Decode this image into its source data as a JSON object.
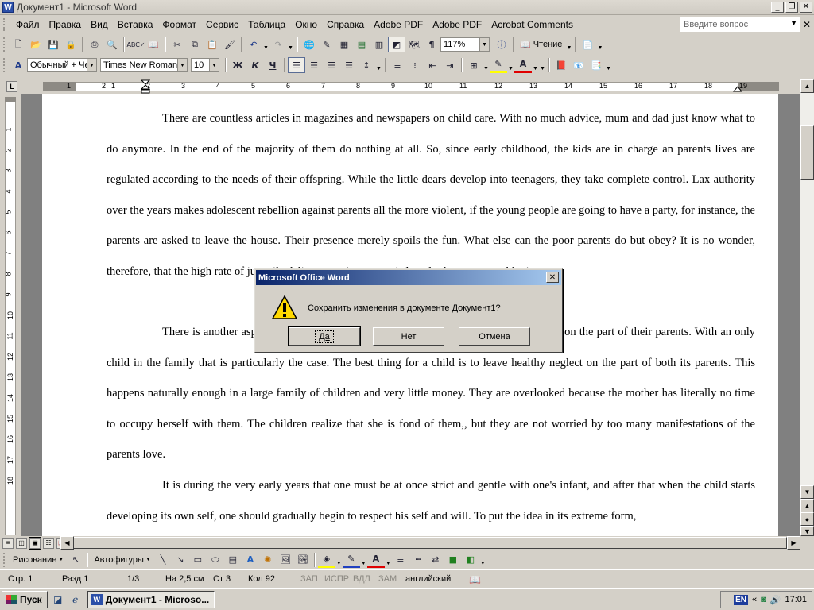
{
  "window": {
    "title": "Документ1 - Microsoft Word",
    "app_icon": "W"
  },
  "menu": {
    "items": [
      "Файл",
      "Правка",
      "Вид",
      "Вставка",
      "Формат",
      "Сервис",
      "Таблица",
      "Окно",
      "Справка",
      "Adobe PDF",
      "Adobe PDF",
      "Acrobat Comments"
    ],
    "ask_placeholder": "Введите вопрос"
  },
  "standard_toolbar": {
    "zoom": "117%",
    "read_label": "Чтение"
  },
  "format_toolbar": {
    "style": "Обычный + Че",
    "font": "Times New Roman",
    "size": "10",
    "bold_label": "Ж",
    "italic_label": "К",
    "underline_label": "Ч"
  },
  "ruler": {
    "numbers": [
      "1",
      "2",
      "1",
      "2",
      "3",
      "4",
      "5",
      "6",
      "7",
      "8",
      "9",
      "10",
      "11",
      "12",
      "13",
      "14",
      "15",
      "16",
      "17",
      "18",
      "19"
    ]
  },
  "vruler": {
    "numbers": [
      "1",
      "2",
      "3",
      "4",
      "5",
      "6",
      "7",
      "8",
      "9",
      "10",
      "11",
      "12",
      "13",
      "14",
      "15",
      "16",
      "17",
      "18"
    ]
  },
  "document": {
    "paragraphs": [
      "There are countless articles in magazines and newspapers on child care. With no much advice, mum and dad just know what to do anymore. In the end of the majority of them do nothing at all. So, since early childhood, the kids are in charge an parents lives are regulated according to the needs of their offspring. While the little dears develop into teenagers, they take complete control. Lax authority over the years makes adolescent rebellion against parents all the more violent, if the young people are going to have a party, for instance, the parents are asked to leave the house. Their presence merely spoils the fun. What else can the poor parents do but obey? It is no wonder, therefore, that the high rate of juvenile delinquency in our age is largely due to parental laxity.",
      "There is another aspect of the problem as children suffer as much from over attention on the part of their parents. With an only child in the family that is particularly the case. The best thing for a child is to leave healthy neglect on the part of both its parents. This happens naturally enough in a large family of children and very little money. They are overlooked because the mother has literally no time to occupy herself with them. The children realize that she is fond of them,, but they are not worried by too many manifestations of the parents love.",
      "It is during the very early years that one must be at once strict and gentle with one's infant, and after that when the child starts developing its own self, one should gradually begin to respect his self and will. To put the idea in its extreme form,"
    ]
  },
  "drawing_toolbar": {
    "draw_label": "Рисование",
    "autoshapes_label": "Автофигуры"
  },
  "status": {
    "page": "Стр. 1",
    "section": "Разд 1",
    "pages": "1/3",
    "at": "На 2,5 см",
    "line": "Ст 3",
    "col": "Кол 92",
    "rec": "ЗАП",
    "trk": "ИСПР",
    "ext": "ВДЛ",
    "ovr": "ЗАМ",
    "lang": "английский"
  },
  "taskbar": {
    "start": "Пуск",
    "task": "Документ1 - Microso...",
    "lang": "EN",
    "time": "17:01"
  },
  "dialog": {
    "title": "Microsoft Office Word",
    "message": "Сохранить изменения в документе Документ1?",
    "yes": "Да",
    "no": "Нет",
    "cancel": "Отмена"
  }
}
